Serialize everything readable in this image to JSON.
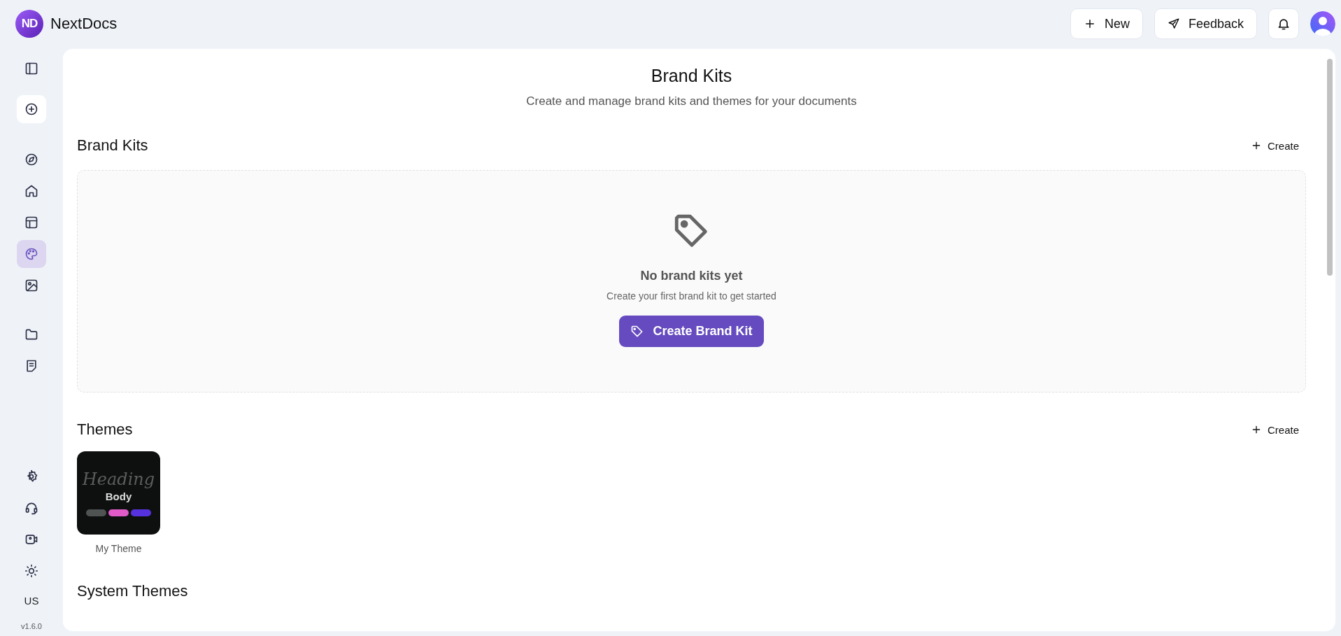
{
  "app": {
    "logo": "ND",
    "name": "NextDocs"
  },
  "header": {
    "new_button": "New",
    "feedback_button": "Feedback"
  },
  "sidebar": {
    "groups": [
      [
        {
          "selected": false
        },
        {
          "selected": false
        }
      ],
      [
        {
          "selected": false
        },
        {
          "selected": false
        },
        {
          "selected": false
        },
        {
          "selected": true
        },
        {
          "selected": false
        }
      ],
      [
        {
          "selected": false
        },
        {
          "selected": false
        }
      ],
      [
        {
          "selected": false
        },
        {
          "selected": false
        },
        {
          "selected": false
        },
        {
          "selected": false
        }
      ]
    ],
    "language": "US",
    "version": "v1.6.0"
  },
  "page": {
    "title": "Brand Kits",
    "subtitle": "Create and manage brand kits and themes for your documents"
  },
  "brand_kits": {
    "heading": "Brand Kits",
    "create": "Create",
    "empty_title": "No brand kits yet",
    "empty_text": "Create your first brand kit to get started",
    "empty_button": "Create Brand Kit"
  },
  "themes": {
    "heading": "Themes",
    "create": "Create",
    "items": [
      {
        "name": "My Theme",
        "preview_heading": "Heading",
        "preview_body": "Body",
        "swatches": [
          {
            "color": "#4f5352"
          },
          {
            "color": "#e05ac8"
          },
          {
            "color": "#5632de"
          }
        ]
      }
    ]
  },
  "system_themes": {
    "heading": "System Themes"
  }
}
